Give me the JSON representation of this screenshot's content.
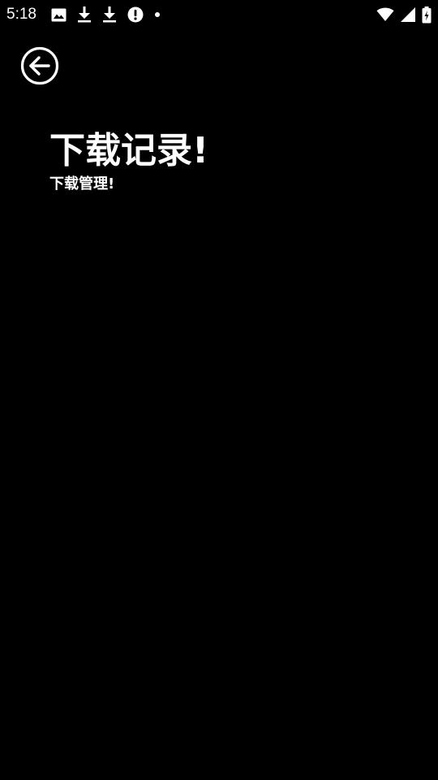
{
  "status_bar": {
    "time": "5:18",
    "left_icons": [
      "image-icon",
      "download-icon",
      "download-icon",
      "alert-icon",
      "dot-icon"
    ],
    "right_icons": [
      "wifi-icon",
      "signal-icon",
      "battery-icon"
    ]
  },
  "header": {
    "title": "下载记录!",
    "subtitle": "下载管理!"
  },
  "colors": {
    "background": "#000000",
    "foreground": "#ffffff"
  }
}
